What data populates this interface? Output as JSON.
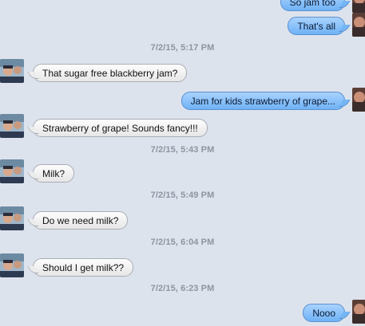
{
  "conversation": {
    "messages": [
      {
        "kind": "outgoing",
        "text": "So jam too"
      },
      {
        "kind": "outgoing",
        "text": "That's all"
      },
      {
        "kind": "timestamp",
        "text": "7/2/15, 5:17 PM"
      },
      {
        "kind": "incoming",
        "text": "That sugar free blackberry jam?"
      },
      {
        "kind": "outgoing",
        "text": "Jam for kids strawberry of grape..."
      },
      {
        "kind": "incoming",
        "text": "Strawberry of grape!  Sounds fancy!!!"
      },
      {
        "kind": "timestamp",
        "text": "7/2/15, 5:43 PM"
      },
      {
        "kind": "incoming",
        "text": "Milk?"
      },
      {
        "kind": "timestamp",
        "text": "7/2/15, 5:49 PM"
      },
      {
        "kind": "incoming",
        "text": "Do we need milk?"
      },
      {
        "kind": "timestamp",
        "text": "7/2/15, 6:04 PM"
      },
      {
        "kind": "incoming",
        "text": "Should I get milk??"
      },
      {
        "kind": "timestamp",
        "text": "7/2/15, 6:23 PM"
      },
      {
        "kind": "outgoing",
        "text": "Nooo"
      }
    ]
  },
  "colors": {
    "background": "#dde3ed",
    "outgoing_bubble": "#8cc4fb",
    "incoming_bubble": "#f2f2f2",
    "timestamp_text": "#8e94a0"
  }
}
